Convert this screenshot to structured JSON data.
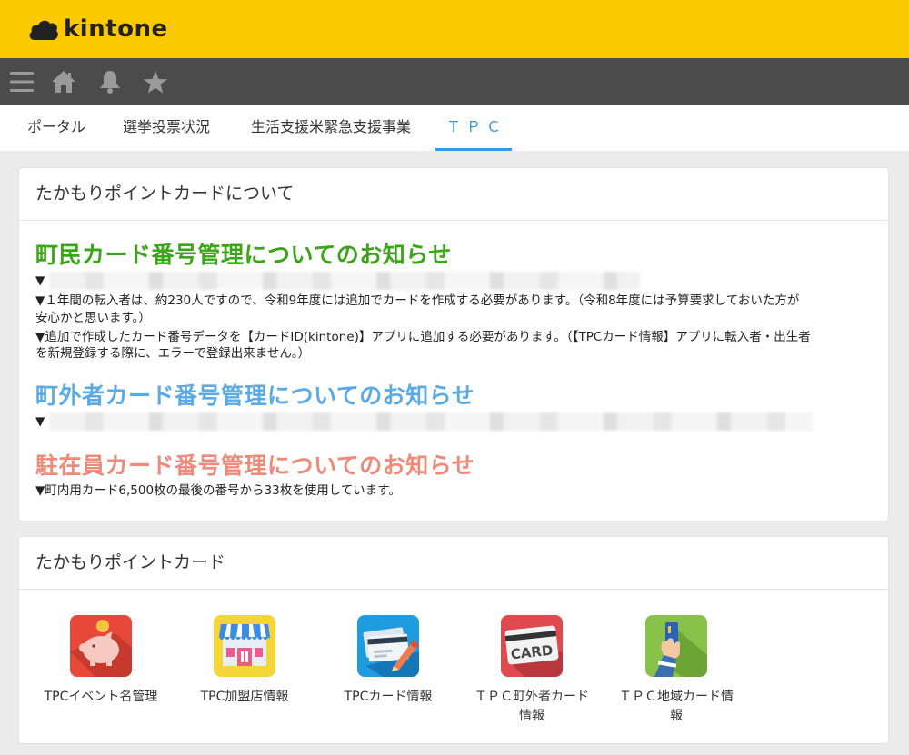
{
  "header": {
    "logo_text": "kintone"
  },
  "toolbar": {
    "icons": [
      "menu-icon",
      "home-icon",
      "bell-icon",
      "star-icon"
    ]
  },
  "tabs": [
    {
      "label": "ポータル",
      "active": false
    },
    {
      "label": "選挙投票状況",
      "active": false
    },
    {
      "label": "生活支援米緊急支援事業",
      "active": false
    },
    {
      "label": "ＴＰＣ",
      "active": true
    }
  ],
  "notice_card": {
    "title": "たかもりポイントカードについて",
    "sections": [
      {
        "heading": "町民カード番号管理についてのお知らせ",
        "color": "#3aa617",
        "lines": [
          "▼",
          "▼１年間の転入者は、約230人ですので、令和9年度には追加でカードを作成する必要があります。（令和8年度には予算要求しておいた方が",
          "安心かと思います。）",
          "▼追加で作成したカード番号データを【カードID(kintone)】アプリに追加する必要があります。（【TPCカード情報】アプリに転入者・出生者",
          "を新規登録する際に、エラーで登録出来ません。）"
        ]
      },
      {
        "heading": "町外者カード番号管理についてのお知らせ",
        "color": "#5aaae6",
        "lines": [
          "▼"
        ]
      },
      {
        "heading": "駐在員カード番号管理についてのお知らせ",
        "color": "#ee8a7a",
        "lines": [
          "▼町内用カード6,500枚の最後の番号から33枚を使用しています。"
        ]
      }
    ]
  },
  "apps_card": {
    "title": "たかもりポイントカード",
    "apps": [
      {
        "label": "TPCイベント名管理",
        "icon": "piggy-bank-icon"
      },
      {
        "label": "TPC加盟店情報",
        "icon": "storefront-icon"
      },
      {
        "label": "TPCカード情報",
        "icon": "card-pen-icon"
      },
      {
        "label_line1": "ＴＰＣ町外者カード",
        "label_line2": "情報",
        "icon": "card-label-icon"
      },
      {
        "label_line1": "ＴＰＣ地域カード情",
        "label_line2": "報",
        "icon": "hand-card-icon"
      }
    ]
  }
}
